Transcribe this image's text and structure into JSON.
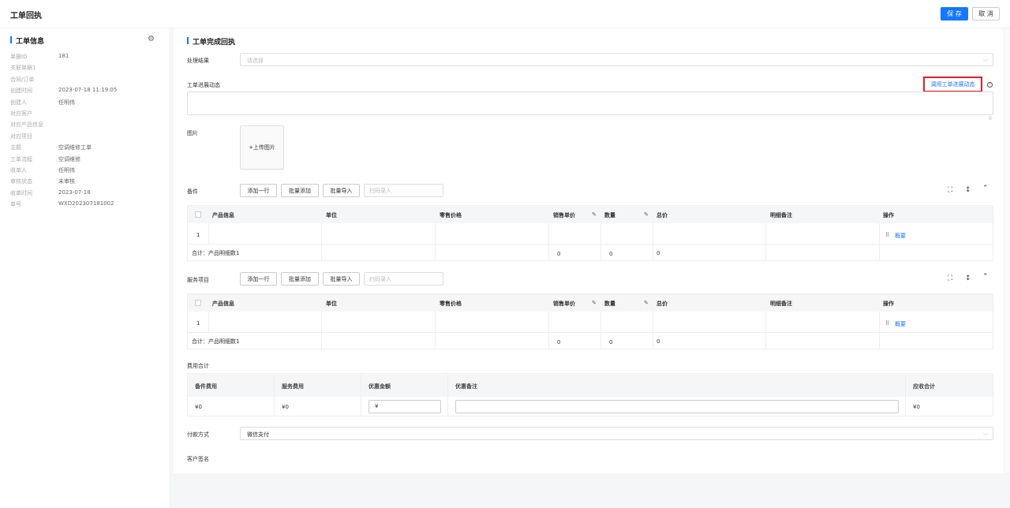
{
  "header": {
    "title": "工单回执",
    "save_label": "保 存",
    "cancel_label": "取 消"
  },
  "left": {
    "title": "工单信息",
    "rows": [
      {
        "k": "单据ID",
        "v": "181"
      },
      {
        "k": "关联单据1",
        "v": ""
      },
      {
        "k": "合同/订单",
        "v": ""
      },
      {
        "k": "创建时间",
        "v": "2023-07-18 11:19:05"
      },
      {
        "k": "创建人",
        "v": "任明伟"
      },
      {
        "k": "对应客户",
        "v": ""
      },
      {
        "k": "对应产品信息",
        "v": ""
      },
      {
        "k": "对应项目",
        "v": ""
      },
      {
        "k": "主题",
        "v": "空调维修工单"
      },
      {
        "k": "工单流程",
        "v": "空调维修"
      },
      {
        "k": "收单人",
        "v": "任明伟"
      },
      {
        "k": "审核状态",
        "v": "未审核"
      },
      {
        "k": "收单时间",
        "v": "2023-07-18"
      },
      {
        "k": "单号",
        "v": "WXD202307181002"
      }
    ]
  },
  "main": {
    "title": "工单完成回执",
    "result_label": "处理结果",
    "result_placeholder": "请选择",
    "progress_label": "工单进展动态",
    "progress_link": "调用工单进展动态",
    "progress_counter": "0",
    "image_label": "图片",
    "upload_label": "+上传图片",
    "parts": {
      "label": "备件",
      "add_row": "添加一行",
      "batch_add": "批量添加",
      "batch_import": "批量导入",
      "scan_placeholder": "扫码录入",
      "columns": [
        "产品信息",
        "单位",
        "零售价格",
        "销售单价",
        "数量",
        "总价",
        "明细备注",
        "操作"
      ],
      "row_index": "1",
      "row_action": "概要",
      "total_label": "合计：产品明细数1",
      "total_sale": "0",
      "total_qty": "0",
      "total_sum": "0"
    },
    "services": {
      "label": "服务项目",
      "add_row": "添加一行",
      "batch_add": "批量添加",
      "batch_import": "批量导入",
      "scan_placeholder": "扫码录入",
      "columns": [
        "产品信息",
        "单位",
        "零售价格",
        "销售单价",
        "数量",
        "总价",
        "明细备注",
        "操作"
      ],
      "row_index": "1",
      "row_action": "概要",
      "total_label": "合计：产品明细数1",
      "total_sale": "0",
      "total_qty": "0",
      "total_sum": "0"
    },
    "fees": {
      "label": "费用合计",
      "columns": [
        "备件费用",
        "服务费用",
        "优惠金额",
        "优惠备注",
        "应收合计"
      ],
      "parts_fee": "¥0",
      "service_fee": "¥0",
      "discount_prefix": "¥",
      "total": "¥0"
    },
    "payment_label": "付款方式",
    "payment_value": "微信支付",
    "signature_label": "客户签名"
  }
}
